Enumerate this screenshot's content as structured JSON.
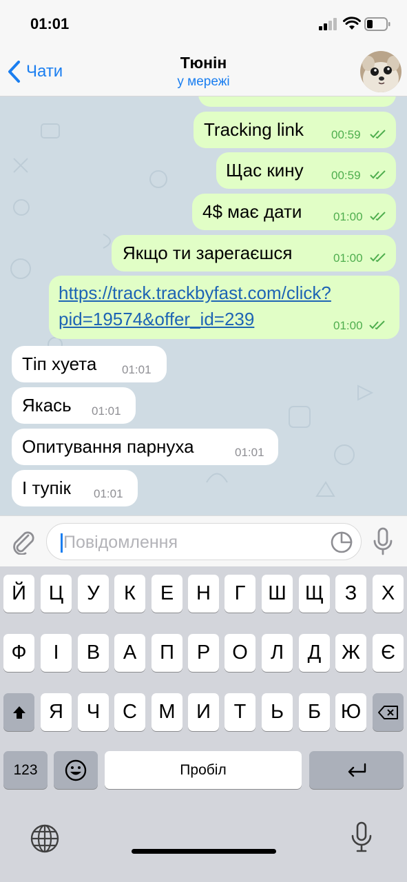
{
  "status_bar": {
    "time": "01:01"
  },
  "header": {
    "back_label": "Чати",
    "title": "Тюнін",
    "status": "у мережі"
  },
  "messages": [
    {
      "direction": "out",
      "text": "Tracking link",
      "time": "00:59",
      "status": "read"
    },
    {
      "direction": "out",
      "text": "Щас кину",
      "time": "00:59",
      "status": "read"
    },
    {
      "direction": "out",
      "text": "4$ має дати",
      "time": "01:00",
      "status": "read"
    },
    {
      "direction": "out",
      "text": "Якщо ти зарегаєшся",
      "time": "01:00",
      "status": "read"
    },
    {
      "direction": "out",
      "text_line1": "https://track.trackbyfast.com/click?",
      "text_line2": "pid=19574&offer_id=239",
      "time": "01:00",
      "status": "read",
      "is_link": true
    },
    {
      "direction": "in",
      "text": "Тіп хуета",
      "time": "01:01"
    },
    {
      "direction": "in",
      "text": "Якась",
      "time": "01:01"
    },
    {
      "direction": "in",
      "text": "Опитування парнуха",
      "time": "01:01"
    },
    {
      "direction": "in",
      "text": "І тупік",
      "time": "01:01"
    }
  ],
  "input": {
    "placeholder": "Повідомлення"
  },
  "keyboard": {
    "row1": [
      "Й",
      "Ц",
      "У",
      "К",
      "Е",
      "Н",
      "Г",
      "Ш",
      "Щ",
      "З",
      "Х"
    ],
    "row2": [
      "Ф",
      "І",
      "В",
      "А",
      "П",
      "Р",
      "О",
      "Л",
      "Д",
      "Ж",
      "Є"
    ],
    "row3": [
      "Я",
      "Ч",
      "С",
      "М",
      "И",
      "Т",
      "Ь",
      "Б",
      "Ю"
    ],
    "numbers_label": "123",
    "space_label": "Пробіл"
  },
  "icons": {
    "back": "chevron-left-icon",
    "attach": "paperclip-icon",
    "sticker": "sticker-icon",
    "mic": "microphone-icon",
    "shift": "shift-icon",
    "delete": "backspace-icon",
    "emoji": "emoji-icon",
    "return": "return-icon",
    "globe": "globe-icon",
    "dictation": "dictation-icon"
  },
  "colors": {
    "accent": "#1a7ef0",
    "outgoing_bubble": "#e1fec6",
    "incoming_bubble": "#ffffff",
    "read_ticks": "#4fae4e",
    "chat_background": "#cfdbe3"
  }
}
